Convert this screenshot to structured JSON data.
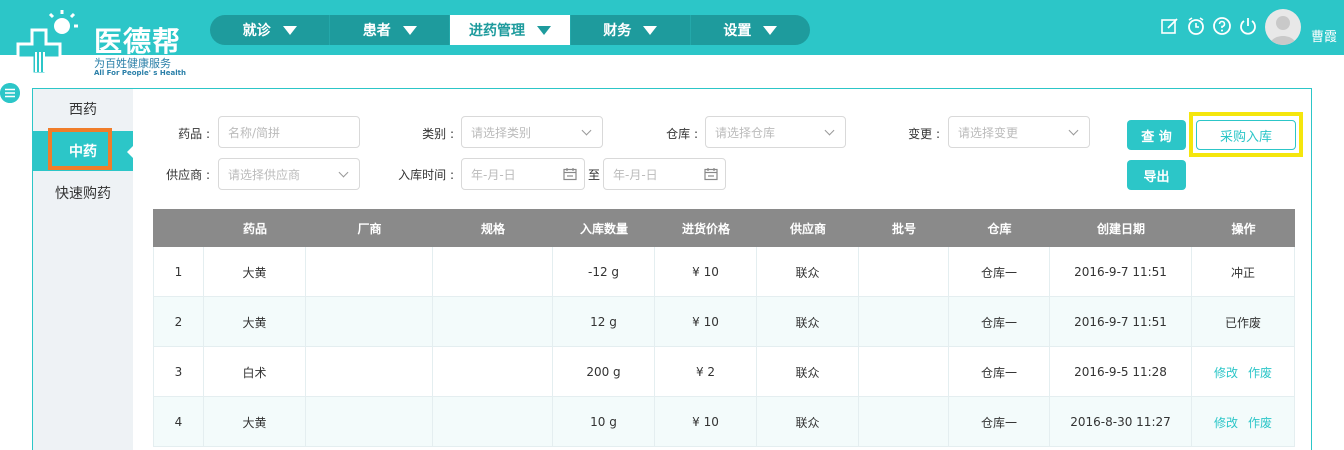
{
  "app": {
    "name": "医德帮",
    "slogan": "为百姓健康服务",
    "slogan_en": "All For People' s Health",
    "accent": "#2cc6c8"
  },
  "nav": {
    "items": [
      {
        "label": "就诊"
      },
      {
        "label": "患者"
      },
      {
        "label": "进药管理",
        "active": true
      },
      {
        "label": "财务"
      },
      {
        "label": "设置"
      }
    ]
  },
  "header": {
    "icons": [
      "edit-icon",
      "alarm-clock-icon",
      "help-icon",
      "power-icon"
    ],
    "username": "曹霞"
  },
  "sidebar": {
    "items": [
      {
        "label": "西药"
      },
      {
        "label": "中药",
        "active": true
      },
      {
        "label": "快速购药"
      }
    ]
  },
  "filters": {
    "drug_label": "药品 :",
    "drug_placeholder": "名称/简拼",
    "category_label": "类别 :",
    "category_placeholder": "请选择类别",
    "warehouse_label": "仓库 :",
    "warehouse_placeholder": "请选择仓库",
    "change_label": "变更 :",
    "change_placeholder": "请选择变更",
    "supplier_label": "供应商 :",
    "supplier_placeholder": "请选择供应商",
    "time_label": "入库时间 :",
    "date_from_placeholder": "年-月-日",
    "to_label": "至",
    "date_to_placeholder": "年-月-日"
  },
  "buttons": {
    "query": "查 询",
    "purchase_in": "采购入库",
    "export": "导出"
  },
  "table": {
    "columns": [
      "",
      "药品",
      "厂商",
      "规格",
      "入库数量",
      "进货价格",
      "供应商",
      "批号",
      "仓库",
      "创建日期",
      "操作"
    ],
    "rows": [
      {
        "no": "1",
        "drug": "大黄",
        "maker": "",
        "spec": "",
        "qty": "-12 g",
        "price": "¥ 10",
        "supplier": "联众",
        "batch": "",
        "warehouse": "仓库一",
        "date": "2016-9-7 11:51",
        "action_text": "冲正",
        "actions": []
      },
      {
        "no": "2",
        "drug": "大黄",
        "maker": "",
        "spec": "",
        "qty": "12 g",
        "price": "¥ 10",
        "supplier": "联众",
        "batch": "",
        "warehouse": "仓库一",
        "date": "2016-9-7 11:51",
        "action_text": "已作废",
        "actions": []
      },
      {
        "no": "3",
        "drug": "白术",
        "maker": "",
        "spec": "",
        "qty": "200 g",
        "price": "¥ 2",
        "supplier": "联众",
        "batch": "",
        "warehouse": "仓库一",
        "date": "2016-9-5 11:28",
        "action_text": "",
        "actions": [
          "修改",
          "作废"
        ]
      },
      {
        "no": "4",
        "drug": "大黄",
        "maker": "",
        "spec": "",
        "qty": "10 g",
        "price": "¥ 10",
        "supplier": "联众",
        "batch": "",
        "warehouse": "仓库一",
        "date": "2016-8-30 11:27",
        "action_text": "",
        "actions": [
          "修改",
          "作废"
        ]
      }
    ]
  }
}
